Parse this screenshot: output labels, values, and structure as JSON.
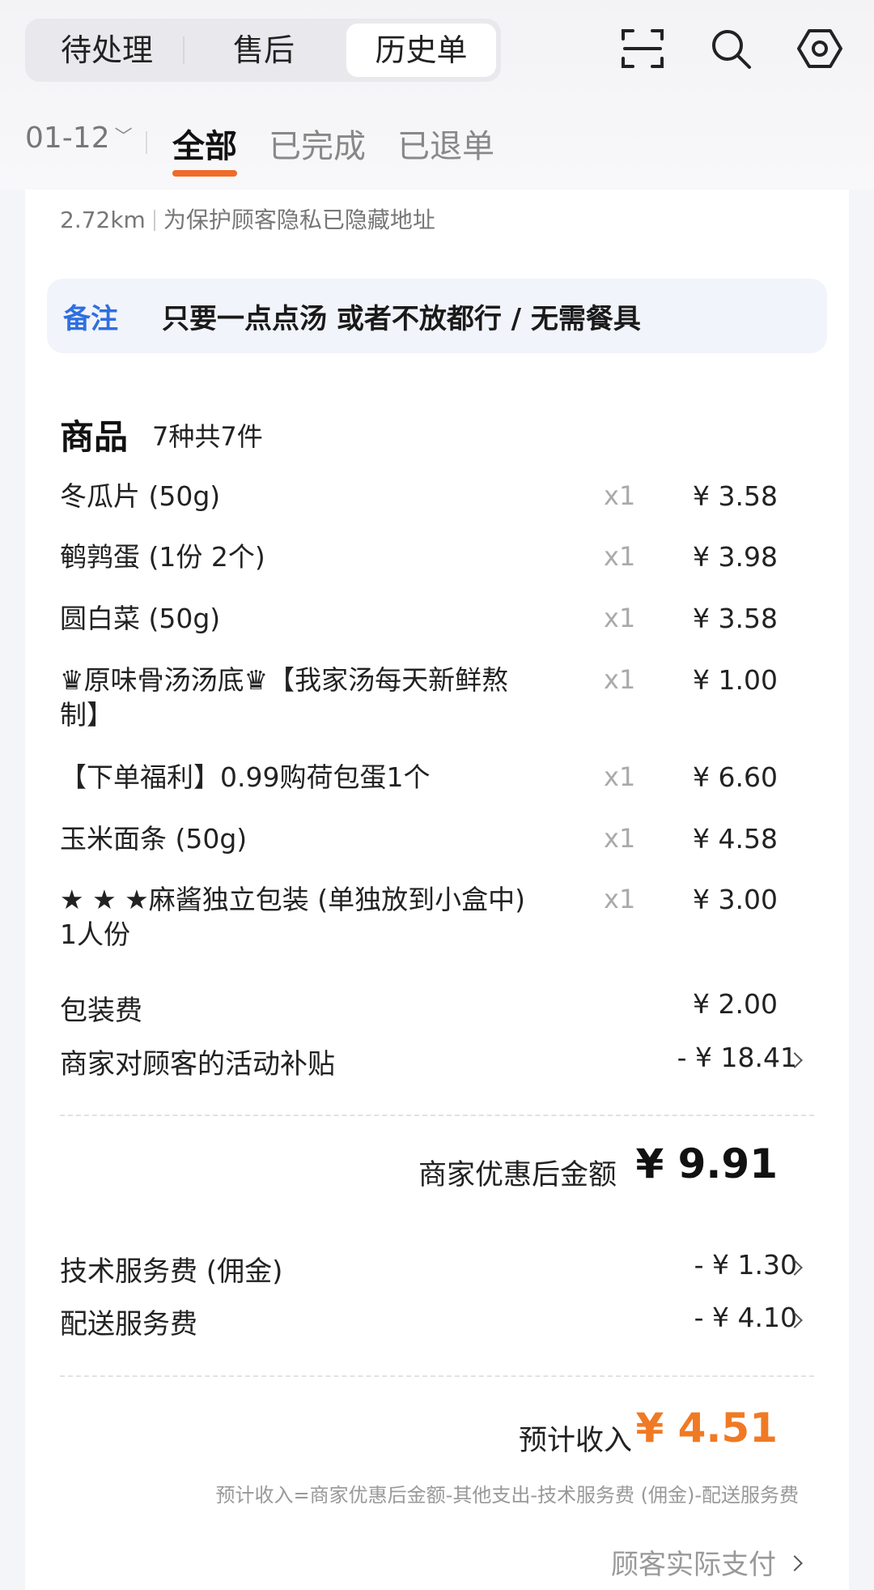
{
  "header": {
    "tabs": [
      "待处理",
      "售后",
      "历史单"
    ],
    "active_tab": "历史单",
    "icons": [
      "scan-icon",
      "search-icon",
      "settings-icon"
    ]
  },
  "filter": {
    "date": "01-12",
    "tabs": [
      "全部",
      "已完成",
      "已退单"
    ],
    "active_tab": "全部"
  },
  "order": {
    "distance": "2.72km",
    "address_note": "为保护顾客隐私已隐藏地址",
    "remark_label": "备注",
    "remark_text": "只要一点点汤 或者不放都行 / 无需餐具",
    "goods_title": "商品",
    "goods_count": "7种共7件",
    "items": [
      {
        "name": "冬瓜片 (50g)",
        "qty": "x1",
        "price": "¥ 3.58"
      },
      {
        "name": "鹌鹑蛋 (1份 2个)",
        "qty": "x1",
        "price": "¥ 3.98"
      },
      {
        "name": "圆白菜 (50g)",
        "qty": "x1",
        "price": "¥ 3.58"
      },
      {
        "name": "♛原味骨汤汤底♛【我家汤每天新鲜熬制】",
        "qty": "x1",
        "price": "¥ 1.00"
      },
      {
        "name": "【下单福利】0.99购荷包蛋1个",
        "qty": "x1",
        "price": "¥ 6.60"
      },
      {
        "name": "玉米面条 (50g)",
        "qty": "x1",
        "price": "¥ 4.58"
      },
      {
        "name": "★ ★ ★麻酱独立包装 (单独放到小盒中) 1人份",
        "qty": "x1",
        "price": "¥ 3.00"
      }
    ],
    "packing_fee_label": "包装费",
    "packing_fee": "¥ 2.00",
    "subsidy_label": "商家对顾客的活动补贴",
    "subsidy": "- ¥ 18.41",
    "subtotal_label": "商家优惠后金额",
    "subtotal": "¥ 9.91",
    "commission_label": "技术服务费 (佣金)",
    "commission": "- ¥ 1.30",
    "delivery_fee_label": "配送服务费",
    "delivery_fee": "- ¥ 4.10",
    "income_label": "预计收入",
    "income": "¥ 4.51",
    "formula": "预计收入=商家优惠后金额-其他支出-技术服务费 (佣金)-配送服务费",
    "customer_paid_label": "顾客实际支付"
  },
  "colors": {
    "accent": "#f06a28",
    "income": "#f07a24",
    "remark_label": "#2f6fe0"
  }
}
